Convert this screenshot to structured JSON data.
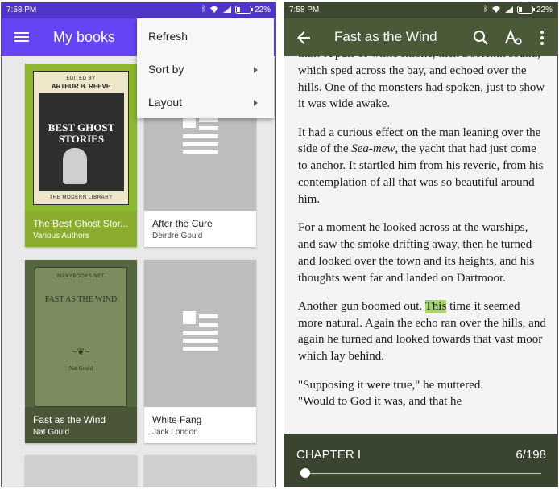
{
  "left": {
    "status_time": "7:58 PM",
    "battery": "22%",
    "app_title": "My books",
    "books": [
      {
        "title": "The Best Ghost Stor...",
        "author": "Various Authors",
        "cover_edited": "EDITED BY",
        "cover_author": "ARTHUR B. REEVE",
        "cover_title": "BEST GHOST STORIES",
        "cover_publisher": "THE MODERN LIBRARY"
      },
      {
        "title": "After the Cure",
        "author": "Deirdre Gould"
      },
      {
        "title": "Fast as the Wind",
        "author": "Nat Gould",
        "cover_url": "MANYBOOKS.NET",
        "cover_title": "FAST AS THE WIND",
        "cover_ornament": "~❦~",
        "cover_author": "Nat Gould"
      },
      {
        "title": "White Fang",
        "author": "Jack London"
      }
    ],
    "menu": [
      "Refresh",
      "Sort by",
      "Layout"
    ]
  },
  "right": {
    "status_time": "7:58 PM",
    "battery": "22%",
    "book_title": "Fast as the Wind",
    "paragraphs": [
      "that? A puff of white smoke, then a solemn sound, which sped across the bay, and echoed over the hills. One of the monsters had spoken, just to show it was wide awake.",
      "Another gun boomed out.",
      "For a moment he looked across at the warships, and saw the smoke drifting away, then he turned and looked over the town and its heights, and his thoughts went far and landed on Dartmoor."
    ],
    "p2_a": "It had a curious effect on the man leaning over the side of the ",
    "p2_em": "Sea-mew",
    "p2_b": ", the yacht that had just come to anchor. It startled him from his reverie, from his contemplation of all that was so beautiful around him.",
    "p4_hl": "This",
    "p4_rest": " time it seemed more natural. Again the echo ran over the hills, and again he turned and looked towards that vast moor which lay behind.",
    "p5": "\"Supposing it were true,\" he muttered.",
    "p6": "\"Would to God it was, and that he",
    "chapter": "CHAPTER I",
    "page": "6/198",
    "progress_fraction": 0.005
  }
}
